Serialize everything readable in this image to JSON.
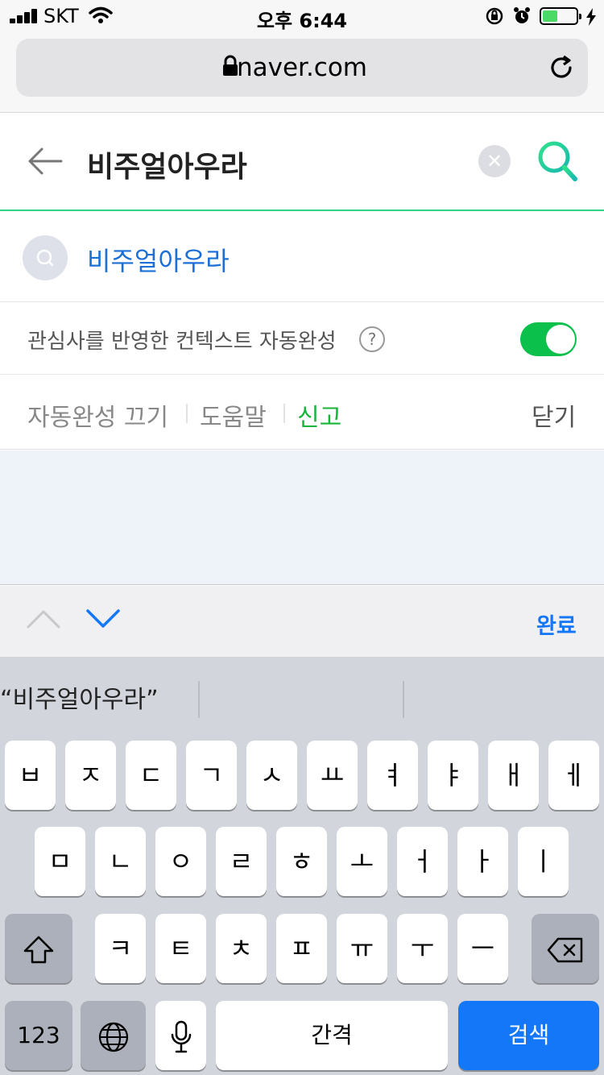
{
  "status": {
    "carrier": "SKT",
    "time": "오후 6:44",
    "battery_level": 0.45
  },
  "browser": {
    "url": "naver.com"
  },
  "search": {
    "query": "비주얼아우라",
    "suggestion": "비주얼아우라",
    "context_label": "관심사를 반영한 컨텍스트 자동완성",
    "help_symbol": "?",
    "context_enabled": true,
    "accent": "#2dd487"
  },
  "links": {
    "autocomplete_off": "자동완성 끄기",
    "help": "도움말",
    "report": "신고",
    "close": "닫기"
  },
  "accessory": {
    "done": "완료"
  },
  "keyboard": {
    "prediction": "“비주얼아우라”",
    "row1": [
      "ㅂ",
      "ㅈ",
      "ㄷ",
      "ㄱ",
      "ㅅ",
      "ㅛ",
      "ㅕ",
      "ㅑ",
      "ㅐ",
      "ㅔ"
    ],
    "row2": [
      "ㅁ",
      "ㄴ",
      "ㅇ",
      "ㄹ",
      "ㅎ",
      "ㅗ",
      "ㅓ",
      "ㅏ",
      "ㅣ"
    ],
    "row3": [
      "ㅋ",
      "ㅌ",
      "ㅊ",
      "ㅍ",
      "ㅠ",
      "ㅜ",
      "ㅡ"
    ],
    "numbers": "123",
    "space": "간격",
    "search": "검색",
    "search_color": "#1477f8"
  }
}
